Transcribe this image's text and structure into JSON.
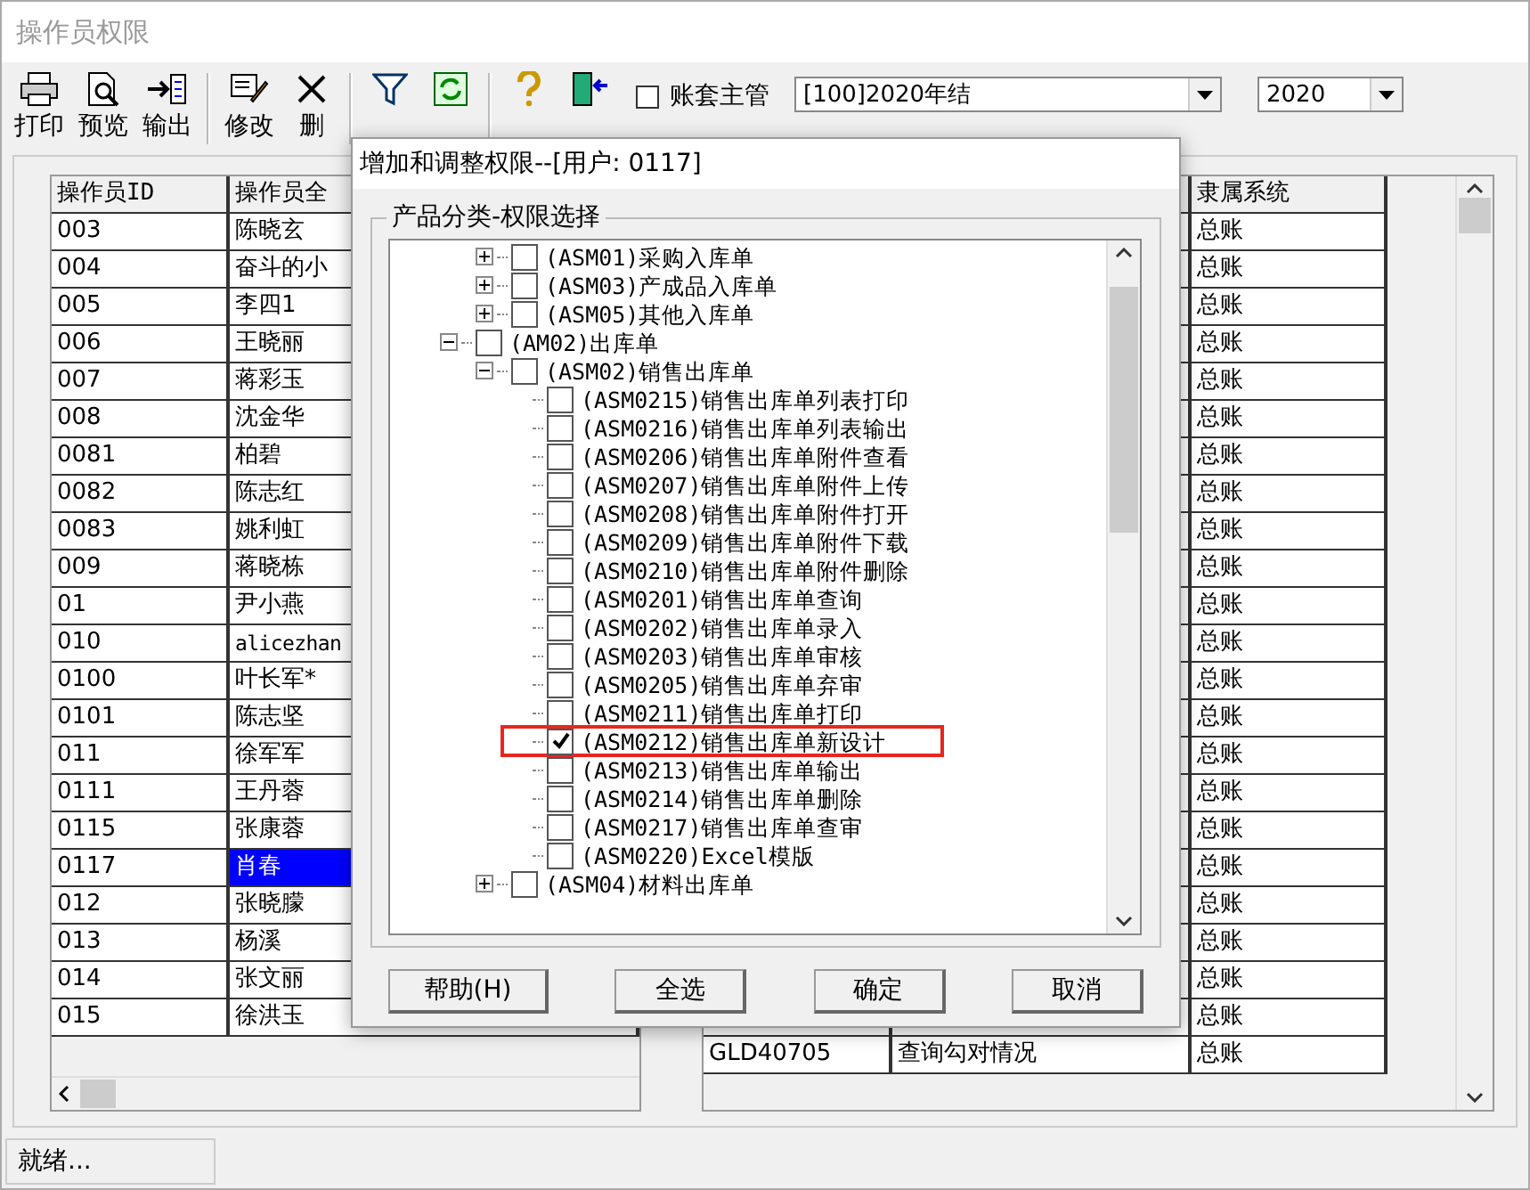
{
  "window": {
    "title": "操作员权限"
  },
  "toolbar": [
    {
      "kind": "print",
      "label": "打印"
    },
    {
      "kind": "preview",
      "label": "预览"
    },
    {
      "kind": "export",
      "label": "输出"
    },
    {
      "kind": "separator"
    },
    {
      "kind": "edit",
      "label": "修改"
    },
    {
      "kind": "delete",
      "label": "删"
    },
    {
      "kind": "separator"
    },
    {
      "kind": "filter"
    },
    {
      "kind": "refresh"
    },
    {
      "kind": "separator"
    },
    {
      "kind": "help"
    },
    {
      "kind": "exit"
    }
  ],
  "supervisor_checkbox": {
    "label": "账套主管",
    "checked": false
  },
  "account_set": {
    "value": "[100]2020年结"
  },
  "year": {
    "value": "2020"
  },
  "operators": {
    "columns": [
      "操作员ID",
      "操作员全"
    ],
    "rows": [
      {
        "id": "003",
        "name": "陈晓玄",
        "selected": false
      },
      {
        "id": "004",
        "name": "奋斗的小",
        "selected": false
      },
      {
        "id": "005",
        "name": "李四1",
        "selected": false
      },
      {
        "id": "006",
        "name": "王晓丽",
        "selected": false
      },
      {
        "id": "007",
        "name": "蒋彩玉",
        "selected": false
      },
      {
        "id": "008",
        "name": "沈金华",
        "selected": false
      },
      {
        "id": "0081",
        "name": "柏碧",
        "selected": false
      },
      {
        "id": "0082",
        "name": "陈志红",
        "selected": false
      },
      {
        "id": "0083",
        "name": "姚利虹",
        "selected": false
      },
      {
        "id": "009",
        "name": "蒋晓栋",
        "selected": false
      },
      {
        "id": "01",
        "name": "尹小燕",
        "selected": false
      },
      {
        "id": "010",
        "name": "alicezhan",
        "selected": false
      },
      {
        "id": "0100",
        "name": "叶长军*",
        "selected": false
      },
      {
        "id": "0101",
        "name": "陈志坚",
        "selected": false
      },
      {
        "id": "011",
        "name": "徐军军",
        "selected": false
      },
      {
        "id": "0111",
        "name": "王丹蓉",
        "selected": false
      },
      {
        "id": "0115",
        "name": "张康蓉",
        "selected": false
      },
      {
        "id": "0117",
        "name": "肖春",
        "selected": true
      },
      {
        "id": "012",
        "name": "张晓朦",
        "selected": false
      },
      {
        "id": "013",
        "name": "杨溪",
        "selected": false
      },
      {
        "id": "014",
        "name": "张文丽",
        "selected": false
      },
      {
        "id": "015",
        "name": "徐洪玉",
        "selected": false
      }
    ]
  },
  "permissions_table": {
    "columns": [
      "隶属系统"
    ],
    "rows": [
      {
        "system": "总账"
      },
      {
        "system": "总账"
      },
      {
        "system": "总账"
      },
      {
        "system": "总账"
      },
      {
        "system": "总账"
      },
      {
        "system": "总账"
      },
      {
        "system": "总账"
      },
      {
        "system": "总账"
      },
      {
        "system": "总账"
      },
      {
        "system": "总账"
      },
      {
        "system": "总账"
      },
      {
        "system": "总账"
      },
      {
        "system": "总账"
      },
      {
        "system": "总账"
      },
      {
        "system": "总账"
      },
      {
        "system": "总账"
      },
      {
        "system": "总账"
      },
      {
        "system": "总账"
      },
      {
        "system": "总账"
      },
      {
        "system": "总账"
      },
      {
        "system": "总账"
      },
      {
        "system": "总账"
      },
      {
        "column_1": "GLD40705",
        "column_2": "查询勾对情况",
        "system": "总账"
      }
    ]
  },
  "dialog": {
    "title": "增加和调整权限--[用户: 0117]",
    "group_title": "产品分类-权限选择",
    "tree": [
      {
        "children": [
          {
            "label": "(ASM01)采购入库单",
            "checked": false,
            "expanded": false,
            "highlighted": false
          },
          {
            "label": "(ASM03)产成品入库单",
            "checked": false,
            "expanded": false,
            "highlighted": false
          },
          {
            "label": "(ASM05)其他入库单",
            "checked": false,
            "expanded": false,
            "highlighted": false
          }
        ]
      },
      {
        "label": "(AM02)出库单",
        "checked": false,
        "expanded": true,
        "highlighted": false,
        "children": [
          {
            "label": "(ASM02)销售出库单",
            "checked": false,
            "expanded": true,
            "highlighted": false,
            "children": [
              {
                "label": "(ASM0215)销售出库单列表打印",
                "checked": false,
                "highlighted": false
              },
              {
                "label": "(ASM0216)销售出库单列表输出",
                "checked": false,
                "highlighted": false
              },
              {
                "label": "(ASM0206)销售出库单附件查看",
                "checked": false,
                "highlighted": false
              },
              {
                "label": "(ASM0207)销售出库单附件上传",
                "checked": false,
                "highlighted": false
              },
              {
                "label": "(ASM0208)销售出库单附件打开",
                "checked": false,
                "highlighted": false
              },
              {
                "label": "(ASM0209)销售出库单附件下载",
                "checked": false,
                "highlighted": false
              },
              {
                "label": "(ASM0210)销售出库单附件删除",
                "checked": false,
                "highlighted": false
              },
              {
                "label": "(ASM0201)销售出库单查询",
                "checked": false,
                "highlighted": false
              },
              {
                "label": "(ASM0202)销售出库单录入",
                "checked": false,
                "highlighted": false
              },
              {
                "label": "(ASM0203)销售出库单审核",
                "checked": false,
                "highlighted": false
              },
              {
                "label": "(ASM0205)销售出库单弃审",
                "checked": false,
                "highlighted": false
              },
              {
                "label": "(ASM0211)销售出库单打印",
                "checked": false,
                "highlighted": false
              },
              {
                "label": "(ASM0212)销售出库单新设计",
                "checked": true,
                "highlighted": true
              },
              {
                "label": "(ASM0213)销售出库单输出",
                "checked": false,
                "highlighted": false
              },
              {
                "label": "(ASM0214)销售出库单删除",
                "checked": false,
                "highlighted": false
              },
              {
                "label": "(ASM0217)销售出库单查审",
                "checked": false,
                "highlighted": false
              },
              {
                "label": "(ASM0220)Excel模版",
                "checked": false,
                "highlighted": false
              }
            ]
          },
          {
            "label": "(ASM04)材料出库单",
            "checked": false,
            "expanded": false,
            "highlighted": false
          }
        ]
      }
    ],
    "buttons": [
      "帮助(H)",
      "全选",
      "确定",
      "取消"
    ]
  },
  "status_bar": {
    "text": "就绪..."
  }
}
